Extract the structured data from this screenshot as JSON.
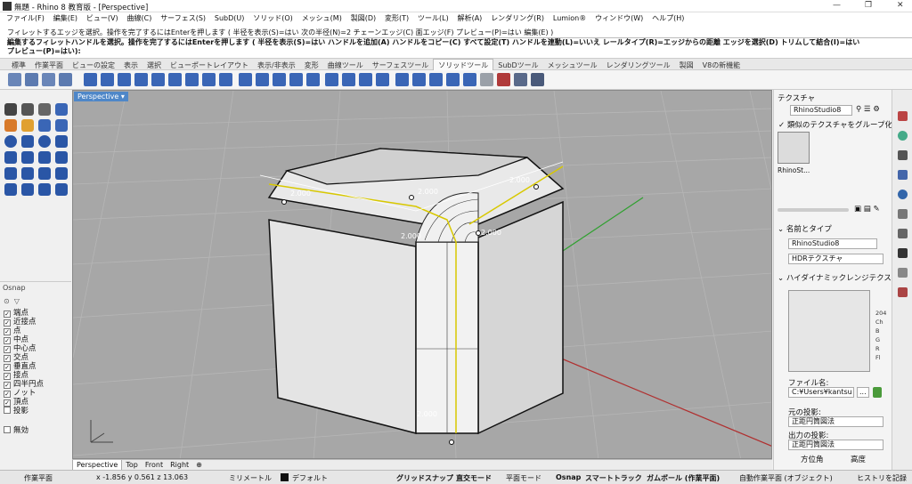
{
  "window": {
    "title": "無題 - Rhino 8 教育版 - [Perspective]",
    "controls": [
      "—",
      "❐",
      "✕"
    ]
  },
  "menu": [
    "ファイル(F)",
    "編集(E)",
    "ビュー(V)",
    "曲線(C)",
    "サーフェス(S)",
    "SubD(U)",
    "ソリッド(O)",
    "メッシュ(M)",
    "製図(D)",
    "変形(T)",
    "ツール(L)",
    "解析(A)",
    "レンダリング(R)",
    "Lumion®",
    "ウィンドウ(W)",
    "ヘルプ(H)"
  ],
  "command": {
    "line1": "フィレットするエッジを選択。操作を完了するにはEnterを押します ( 半径を表示(S)=はい  次の半径(N)=2  チェーンエッジ(C)  面エッジ(F)  プレビュー(P)=はい  編集(E) )",
    "line2": "編集するフィレットハンドルを選択。操作を完了するにはEnterを押します ( 半径を表示(S)=はい  ハンドルを追加(A)  ハンドルをコピー(C)  すべて設定(T)  ハンドルを連動(L)=いいえ  レールタイプ(R)=エッジからの距離  エッジを選択(D)  トリムして結合(I)=はい",
    "prompt": "プレビュー(P)=はい):"
  },
  "tabs": [
    "標準",
    "作業平面",
    "ビューの設定",
    "表示",
    "選択",
    "ビューポートレイアウト",
    "表示/非表示",
    "変形",
    "曲線ツール",
    "サーフェスツール",
    "ソリッドツール",
    "SubDツール",
    "メッシュツール",
    "レンダリングツール",
    "製図",
    "V8の新機能"
  ],
  "active_tab": "ソリッドツール",
  "viewport": {
    "name": "Perspective",
    "fillet_labels": [
      "2.000",
      "2.000",
      "2.000",
      "2.000",
      "2.000",
      "2.000"
    ]
  },
  "viewport_tabs": [
    "Perspective",
    "Top",
    "Front",
    "Right",
    "⊕"
  ],
  "osnap": {
    "title": "Osnap",
    "items": [
      {
        "label": "端点",
        "checked": true
      },
      {
        "label": "近接点",
        "checked": true
      },
      {
        "label": "点",
        "checked": true
      },
      {
        "label": "中点",
        "checked": true
      },
      {
        "label": "中心点",
        "checked": true
      },
      {
        "label": "交点",
        "checked": true
      },
      {
        "label": "垂直点",
        "checked": true
      },
      {
        "label": "接点",
        "checked": true
      },
      {
        "label": "四半円点",
        "checked": true
      },
      {
        "label": "ノット",
        "checked": true
      },
      {
        "label": "頂点",
        "checked": true
      },
      {
        "label": "投影",
        "checked": false
      },
      {
        "label": "無効",
        "checked": false
      }
    ]
  },
  "right_panel": {
    "title": "テクスチャ",
    "dropdown": "RhinoStudio8",
    "group_check": "類似のテクスチャをグループ化",
    "thumb_label": "RhinoSt...",
    "section_name": "名前とタイプ",
    "name_value": "RhinoStudio8",
    "type_value": "HDRテクスチャ",
    "section_hdr": "ハイダイナミックレンジテクス",
    "hdr_info": [
      "204",
      "Ch",
      "B",
      "G",
      "R",
      "Fl"
    ],
    "file_label": "ファイル名:",
    "file_value": "C:¥Users¥kantsu",
    "file_btn": "...",
    "src_proj_label": "元の投影:",
    "src_proj_value": "正距円筒図法",
    "out_proj_label": "出力の投影:",
    "out_proj_value": "正距円筒図法",
    "azimuth_label": "方位角",
    "altitude_label": "高度"
  },
  "status": {
    "cplane": "作業平面",
    "coords": "x -1.856  y 0.561  z 13.063",
    "units": "ミリメートル",
    "layer": "デフォルト",
    "grid_snap": "グリッドスナップ",
    "ortho": "直交モード",
    "planar": "平面モード",
    "osnap": "Osnap",
    "smarttrack": "スマートトラック",
    "gumball": "ガムボール (作業平面)",
    "auto_cplane": "自動作業平面 (オブジェクト)",
    "history": "ヒストリを記録"
  }
}
